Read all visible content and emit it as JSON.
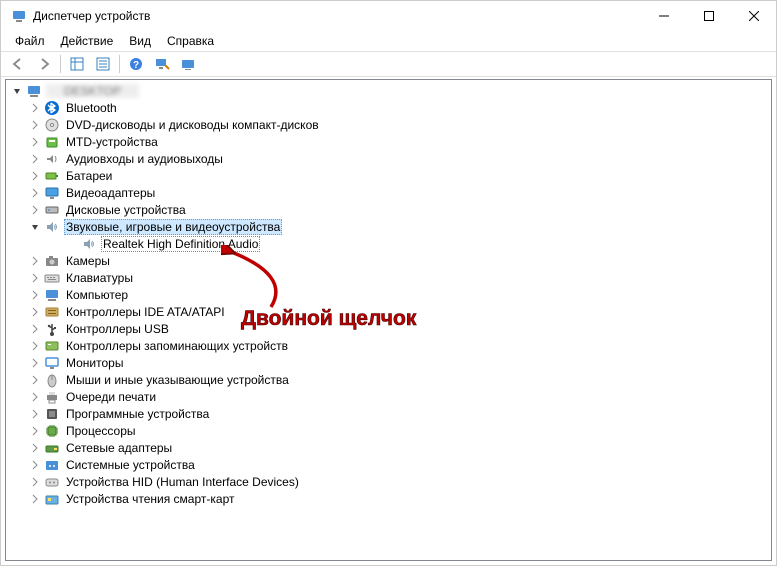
{
  "window": {
    "title": "Диспетчер устройств"
  },
  "menu": {
    "file": "Файл",
    "action": "Действие",
    "view": "Вид",
    "help": "Справка"
  },
  "root": {
    "label": "DESKTOP"
  },
  "categories": [
    {
      "icon": "bluetooth",
      "label": "Bluetooth",
      "expanded": false
    },
    {
      "icon": "disc",
      "label": "DVD-дисководы и дисководы компакт-дисков",
      "expanded": false
    },
    {
      "icon": "mtd",
      "label": "MTD-устройства",
      "expanded": false
    },
    {
      "icon": "audio-jack",
      "label": "Аудиовходы и аудиовыходы",
      "expanded": false
    },
    {
      "icon": "battery",
      "label": "Батареи",
      "expanded": false
    },
    {
      "icon": "display",
      "label": "Видеоадаптеры",
      "expanded": false
    },
    {
      "icon": "hdd",
      "label": "Дисковые устройства",
      "expanded": false
    },
    {
      "icon": "speaker",
      "label": "Звуковые, игровые и видеоустройства",
      "expanded": true,
      "selected": true,
      "children": [
        {
          "icon": "speaker",
          "label": "Realtek High Definition Audio",
          "selected": true
        }
      ]
    },
    {
      "icon": "camera",
      "label": "Камеры",
      "expanded": false
    },
    {
      "icon": "keyboard",
      "label": "Клавиатуры",
      "expanded": false
    },
    {
      "icon": "computer",
      "label": "Компьютер",
      "expanded": false
    },
    {
      "icon": "ide",
      "label": "Контроллеры IDE ATA/ATAPI",
      "expanded": false
    },
    {
      "icon": "usb",
      "label": "Контроллеры USB",
      "expanded": false
    },
    {
      "icon": "storage",
      "label": "Контроллеры запоминающих устройств",
      "expanded": false
    },
    {
      "icon": "monitor",
      "label": "Мониторы",
      "expanded": false
    },
    {
      "icon": "mouse",
      "label": "Мыши и иные указывающие устройства",
      "expanded": false
    },
    {
      "icon": "printer",
      "label": "Очереди печати",
      "expanded": false
    },
    {
      "icon": "firmware",
      "label": "Программные устройства",
      "expanded": false
    },
    {
      "icon": "cpu",
      "label": "Процессоры",
      "expanded": false
    },
    {
      "icon": "network",
      "label": "Сетевые адаптеры",
      "expanded": false
    },
    {
      "icon": "system",
      "label": "Системные устройства",
      "expanded": false
    },
    {
      "icon": "hid",
      "label": "Устройства HID (Human Interface Devices)",
      "expanded": false
    },
    {
      "icon": "smartcard",
      "label": "Устройства чтения смарт-карт",
      "expanded": false
    }
  ],
  "annotation": {
    "text": "Двойной щелчок"
  }
}
